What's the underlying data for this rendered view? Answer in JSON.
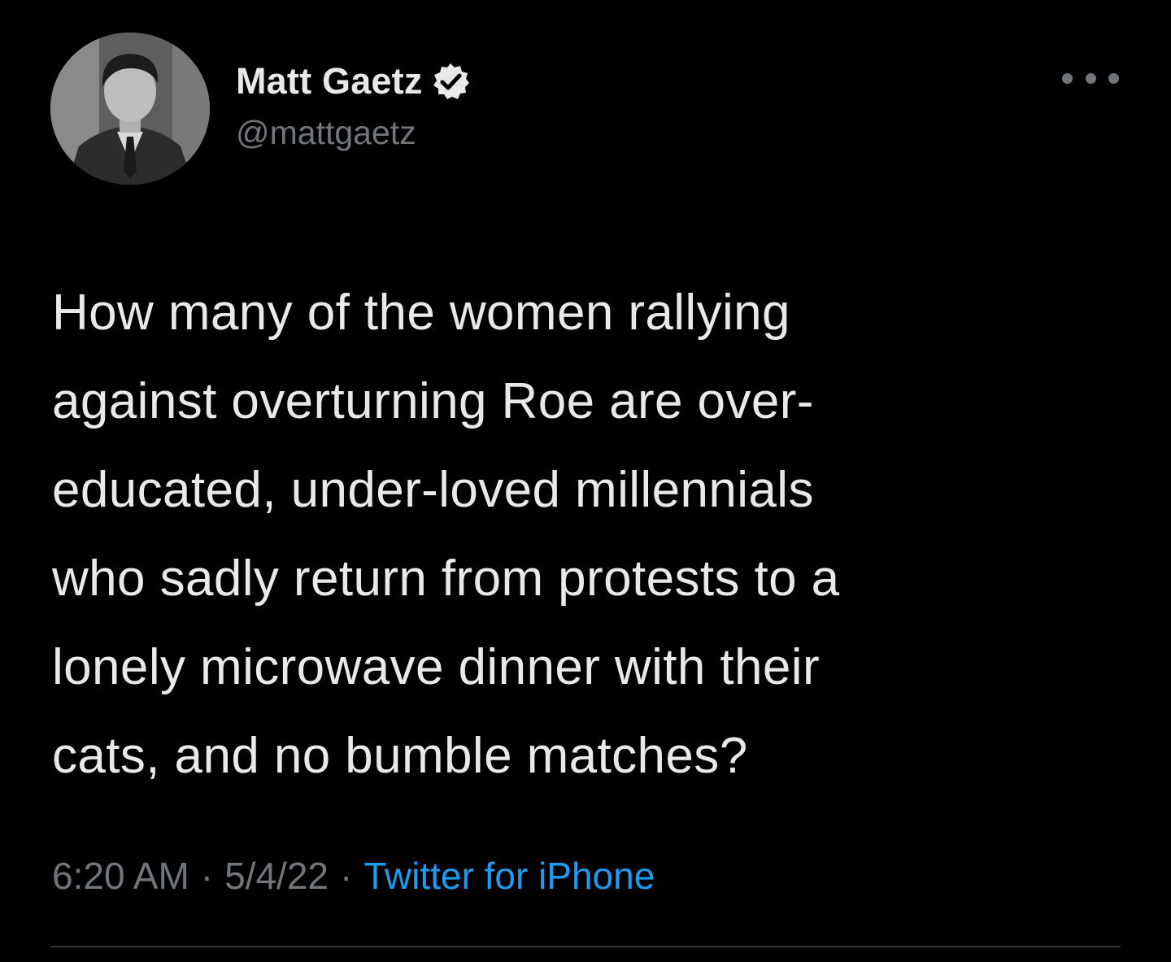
{
  "author": {
    "display_name": "Matt Gaetz",
    "handle": "@mattgaetz",
    "verified": true
  },
  "tweet": {
    "text_lines": [
      "How many of the women rallying",
      "against overturning Roe are over-",
      "educated, under-loved millennials",
      "who sadly return from protests to a",
      "lonely microwave dinner with their",
      "cats, and no bumble matches?"
    ],
    "time": "6:20 AM",
    "date": "5/4/22",
    "separator": "·",
    "source": "Twitter for iPhone"
  },
  "icons": {
    "avatar": "profile-photo",
    "verified": "verified-badge-icon",
    "more": "more-options-icon"
  },
  "colors": {
    "background": "#000000",
    "primary_text": "#e7e9ea",
    "secondary_text": "#71767b",
    "link": "#1d9bf0",
    "divider": "#2f3336"
  }
}
